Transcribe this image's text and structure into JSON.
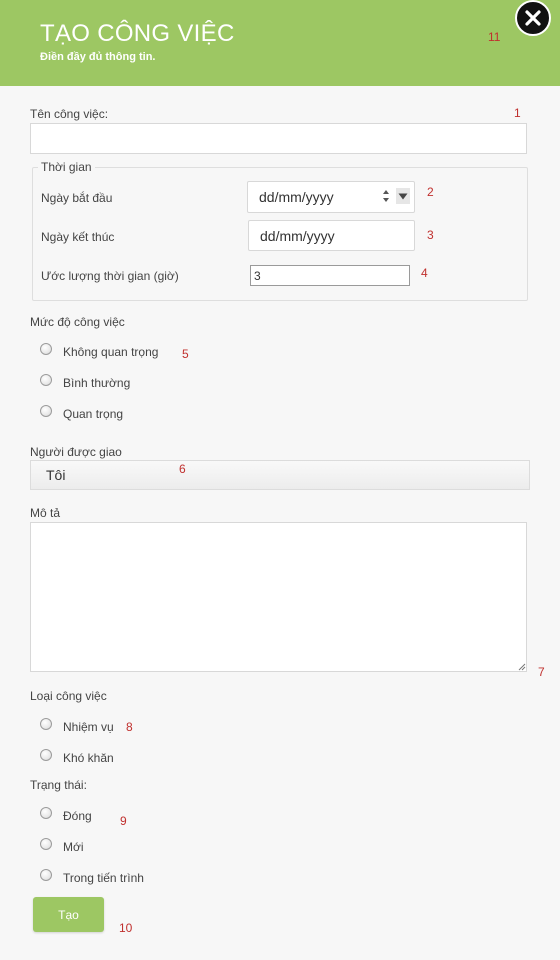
{
  "header": {
    "title": "TẠO CÔNG VIỆC",
    "subtitle": "Điền đầy đủ thông tin."
  },
  "form": {
    "task_name_label": "Tên công việc:",
    "task_name_value": "",
    "time_group_label": "Thời gian",
    "start_date_label": "Ngày bắt đầu",
    "start_date_value": "dd/mm/yyyy",
    "end_date_label": "Ngày kết thúc",
    "end_date_value": "dd/mm/yyyy",
    "estimate_label": "Ước lượng thời gian (giờ)",
    "estimate_value": "3",
    "priority_label": "Mức độ công việc",
    "priority_options": [
      "Không quan trọng",
      "Bình thường",
      "Quan trọng"
    ],
    "assignee_label": "Người được giao",
    "assignee_value": "Tôi",
    "description_label": "Mô tả",
    "description_value": "",
    "type_label": "Loại công việc",
    "type_options": [
      "Nhiệm vụ",
      "Khó khăn"
    ],
    "status_label": "Trạng thái:",
    "status_options": [
      "Đóng",
      "Mới",
      "Trong tiến trình"
    ],
    "submit_label": "Tạo"
  },
  "annotations": [
    "1",
    "2",
    "3",
    "4",
    "5",
    "6",
    "7",
    "8",
    "9",
    "10",
    "11"
  ],
  "colors": {
    "header_bg": "#9dc763",
    "button_bg": "#9dc763",
    "annotation": "#c0302e",
    "form_bg": "#f7f7f7"
  },
  "icons": {
    "close": "close-icon",
    "spinner": "spinner-arrows-icon",
    "dropdown": "dropdown-arrow-icon",
    "resize": "resize-grip-icon"
  }
}
